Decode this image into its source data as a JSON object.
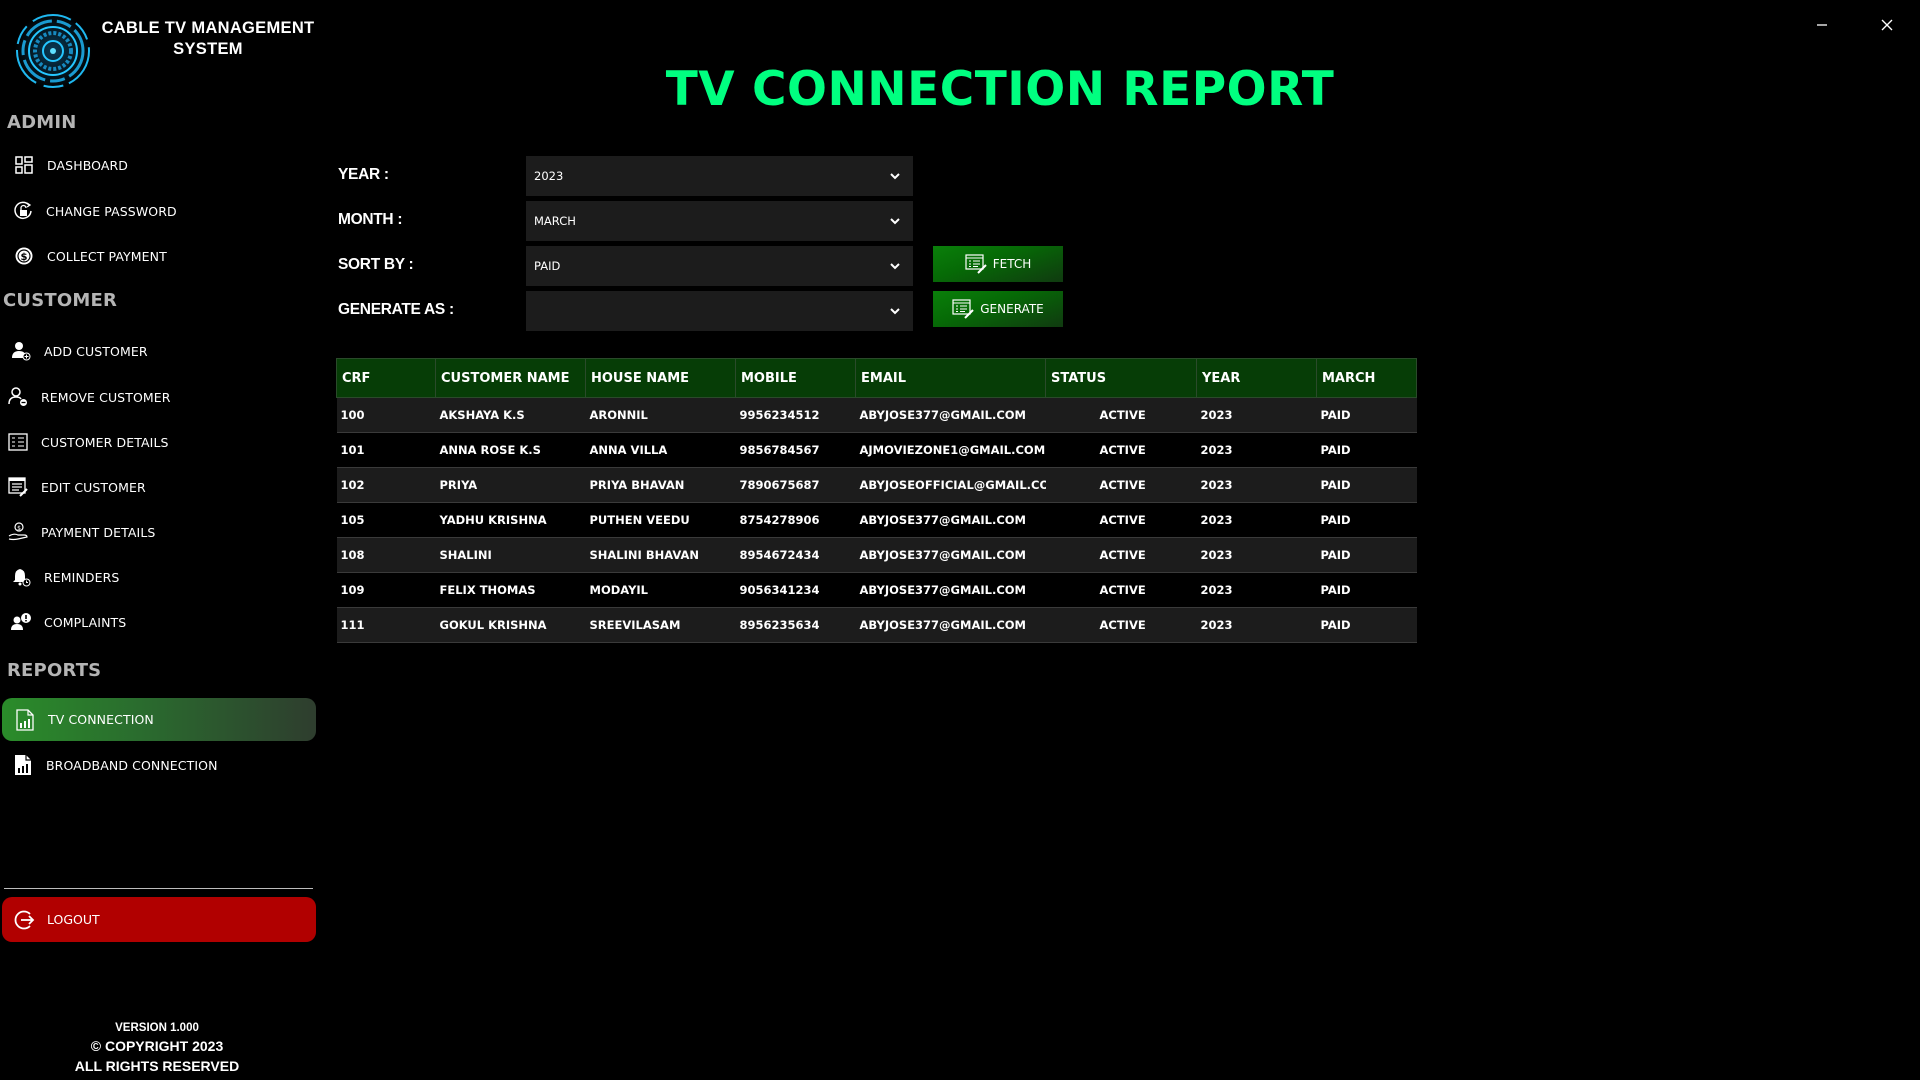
{
  "app": {
    "title": "CABLE TV MANAGEMENT SYSTEM",
    "logo_icon": "circular-tech-emblem-icon"
  },
  "window_controls": {
    "minimize": "minimize-icon",
    "close": "close-icon"
  },
  "sidebar": {
    "sections": [
      {
        "title": "ADMIN",
        "items": [
          {
            "label": "DASHBOARD",
            "icon": "dashboard-grid-icon"
          },
          {
            "label": "CHANGE PASSWORD",
            "icon": "lock-refresh-icon"
          },
          {
            "label": "COLLECT PAYMENT",
            "icon": "dollar-coin-icon"
          }
        ]
      },
      {
        "title": "CUSTOMER",
        "items": [
          {
            "label": "ADD CUSTOMER",
            "icon": "user-add-icon"
          },
          {
            "label": "REMOVE CUSTOMER",
            "icon": "user-remove-icon"
          },
          {
            "label": "CUSTOMER DETAILS",
            "icon": "list-details-icon"
          },
          {
            "label": "EDIT CUSTOMER",
            "icon": "edit-list-icon"
          },
          {
            "label": "PAYMENT DETAILS",
            "icon": "hand-money-icon"
          },
          {
            "label": "REMINDERS",
            "icon": "bell-clock-icon"
          },
          {
            "label": "COMPLAINTS",
            "icon": "user-alert-icon"
          }
        ]
      },
      {
        "title": "REPORTS",
        "items": [
          {
            "label": "TV CONNECTION",
            "icon": "report-chart-icon",
            "active": true
          },
          {
            "label": "BROADBAND CONNECTION",
            "icon": "report-chart-filled-icon"
          }
        ]
      }
    ],
    "logout_label": "LOGOUT",
    "footer": {
      "version": "VERSION 1.000",
      "copyright": "© COPYRIGHT 2023",
      "rights": "ALL RIGHTS RESERVED"
    }
  },
  "main": {
    "title": "TV CONNECTION REPORT",
    "form": {
      "year": {
        "label": "YEAR :",
        "value": "2023"
      },
      "month": {
        "label": "MONTH :",
        "value": "MARCH"
      },
      "sort_by": {
        "label": "SORT BY :",
        "value": "PAID"
      },
      "generate_as": {
        "label": "GENERATE AS :",
        "value": ""
      }
    },
    "buttons": {
      "fetch": "FETCH",
      "generate": "GENERATE"
    },
    "table": {
      "columns": [
        "CRF",
        "CUSTOMER NAME",
        "HOUSE NAME",
        "MOBILE",
        "EMAIL",
        "STATUS",
        "YEAR",
        "MARCH"
      ],
      "rows": [
        [
          "100",
          "AKSHAYA K.S",
          "ARONNIL",
          "9956234512",
          "ABYJOSE377@GMAIL.COM",
          "ACTIVE",
          "2023",
          "PAID"
        ],
        [
          "101",
          "ANNA ROSE K.S",
          "ANNA VILLA",
          "9856784567",
          "AJMOVIEZONE1@GMAIL.COM",
          "ACTIVE",
          "2023",
          "PAID"
        ],
        [
          "102",
          "PRIYA",
          "PRIYA BHAVAN",
          "7890675687",
          "ABYJOSEOFFICIAL@GMAIL.COM",
          "ACTIVE",
          "2023",
          "PAID"
        ],
        [
          "105",
          "YADHU KRISHNA",
          "PUTHEN VEEDU",
          "8754278906",
          "ABYJOSE377@GMAIL.COM",
          "ACTIVE",
          "2023",
          "PAID"
        ],
        [
          "108",
          "SHALINI",
          "SHALINI BHAVAN",
          "8954672434",
          "ABYJOSE377@GMAIL.COM",
          "ACTIVE",
          "2023",
          "PAID"
        ],
        [
          "109",
          "FELIX THOMAS",
          "MODAYIL",
          "9056341234",
          "ABYJOSE377@GMAIL.COM",
          "ACTIVE",
          "2023",
          "PAID"
        ],
        [
          "111",
          "GOKUL KRISHNA",
          "SREEVILASAM",
          "8956235634",
          "ABYJOSE377@GMAIL.COM",
          "ACTIVE",
          "2023",
          "PAID"
        ]
      ]
    }
  },
  "colors": {
    "title_green": "#00ff80",
    "active_nav_green": "#2a8c2a",
    "button_green": "#0a7f0a",
    "table_header_green": "#063d06",
    "logout_red": "#b10000",
    "row_dark": "#1c1c1c",
    "logo_cyan": "#1fb8f0"
  }
}
